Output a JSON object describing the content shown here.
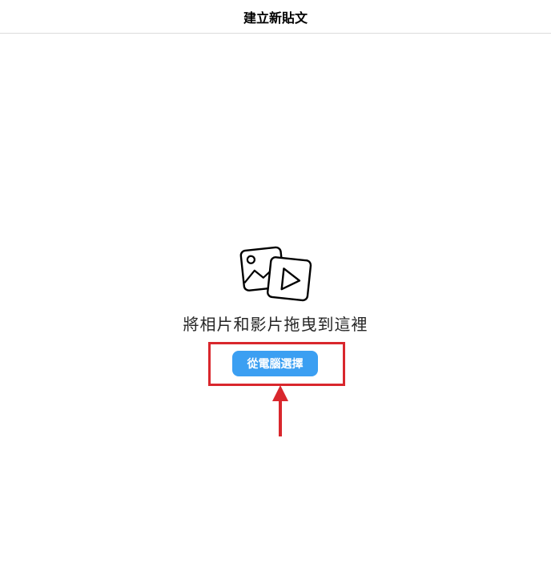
{
  "header": {
    "title": "建立新貼文"
  },
  "dropzone": {
    "icon": "photo-video-icon",
    "message": "將相片和影片拖曳到這裡",
    "select_button_label": "從電腦選擇"
  },
  "annotation": {
    "highlight_color": "#d9272d",
    "arrow_color": "#d9272d"
  },
  "colors": {
    "primary_button": "#3b9ff2",
    "divider": "#dbdbdb"
  }
}
